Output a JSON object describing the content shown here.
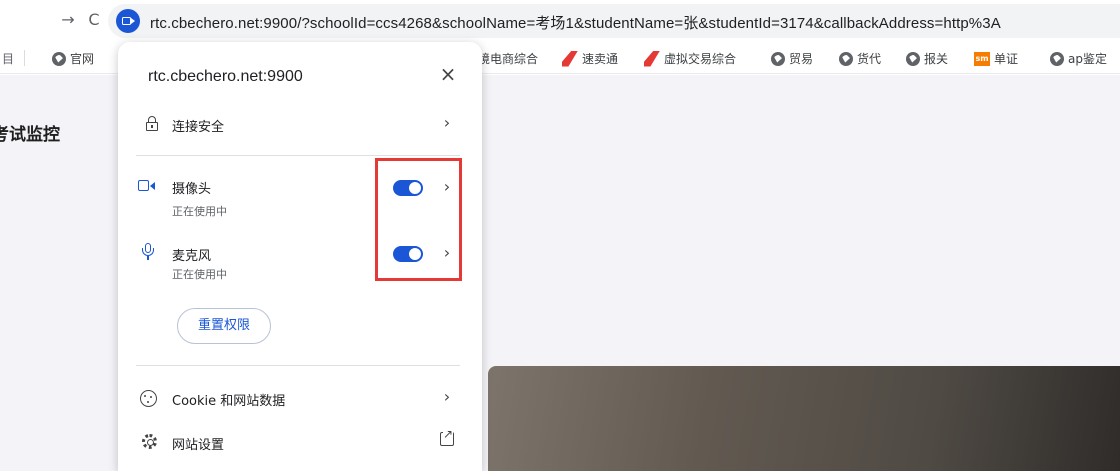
{
  "browser": {
    "back_glyph": "→",
    "reload_glyph": "C",
    "url": "rtc.cbechero.net:9900/?schoolId=ccs4268&schoolName=考场1&studentName=张&studentId=3174&callbackAddress=http%3A"
  },
  "bookmarks": {
    "partial_glyph": "目",
    "items": [
      {
        "label": "官网",
        "icon": "globe-icon"
      },
      {
        "label": "境电商综合",
        "icon": "none"
      },
      {
        "label": "速卖通",
        "icon": "red-logo"
      },
      {
        "label": "虚拟交易综合",
        "icon": "red-logo"
      },
      {
        "label": "贸易",
        "icon": "globe-icon"
      },
      {
        "label": "货代",
        "icon": "globe-icon"
      },
      {
        "label": "报关",
        "icon": "globe-icon"
      },
      {
        "label": "单证",
        "icon": "orange-logo"
      },
      {
        "label": "ap鉴定",
        "icon": "globe-icon"
      }
    ]
  },
  "page": {
    "title": "考试监控"
  },
  "popup": {
    "host": "rtc.cbechero.net:9900",
    "close_glyph": "×",
    "connection": {
      "label": "连接安全",
      "icon": "lock-icon"
    },
    "camera": {
      "label": "摄像头",
      "status": "正在使用中",
      "enabled": true,
      "icon": "camera-icon"
    },
    "microphone": {
      "label": "麦克风",
      "status": "正在使用中",
      "enabled": true,
      "icon": "microphone-icon"
    },
    "reset_label": "重置权限",
    "cookies": {
      "label": "Cookie 和网站数据",
      "icon": "cookie-icon"
    },
    "site_settings": {
      "label": "网站设置",
      "icon": "gear-icon",
      "trailing_icon": "external-link-icon"
    },
    "chevron_glyph": "›"
  },
  "colors": {
    "accent": "#1a56d6",
    "highlight": "#e53935"
  }
}
